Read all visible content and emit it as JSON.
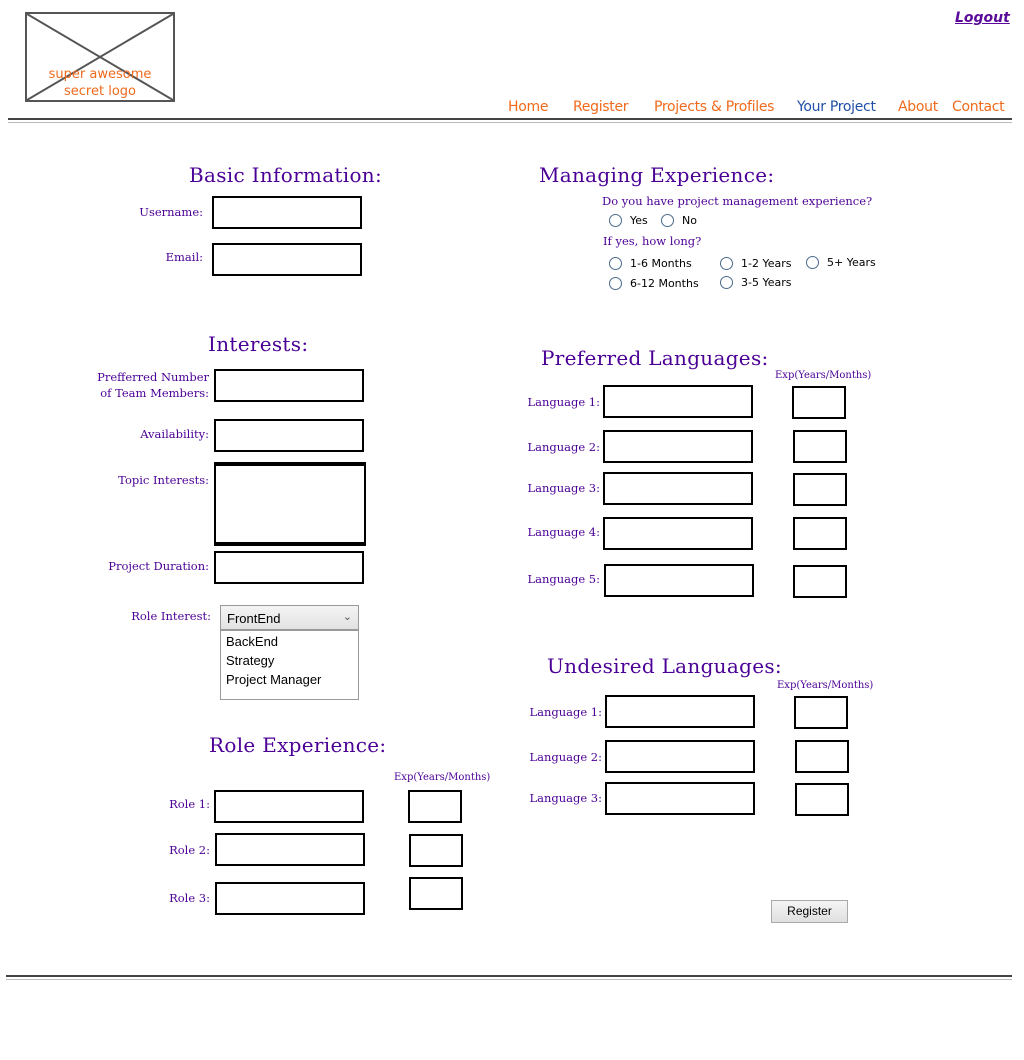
{
  "header": {
    "logo_text_1": "super awesome",
    "logo_text_2": "secret logo",
    "logout": "Logout",
    "nav": [
      "Home",
      "Register",
      "Projects & Profiles",
      "Your Project",
      "About",
      "Contact"
    ]
  },
  "basic": {
    "title": "Basic Information:",
    "username_label": "Username:",
    "email_label": "Email:"
  },
  "interests": {
    "title": "Interests:",
    "team_label_1": "Prefferred Number",
    "team_label_2": "of Team Members:",
    "availability_label": "Availability:",
    "topic_label": "Topic Interests:",
    "duration_label": "Project Duration:",
    "role_label": "Role Interest:",
    "role_selected": "FrontEnd",
    "role_options": [
      "BackEnd",
      "Strategy",
      "Project Manager"
    ]
  },
  "role_exp": {
    "title": "Role Experience:",
    "exp_label": "Exp(Years/Months)",
    "roles": [
      "Role 1:",
      "Role 2:",
      "Role 3:"
    ]
  },
  "managing": {
    "title": "Managing Experience:",
    "question": "Do you have project management experience?",
    "yes": "Yes",
    "no": "No",
    "how_long": "If yes, how long?",
    "durations": [
      "1-6 Months",
      "1-2 Years",
      "5+ Years",
      "6-12 Months",
      "3-5 Years"
    ]
  },
  "preferred": {
    "title": "Preferred Languages:",
    "exp_label": "Exp(Years/Months)",
    "languages": [
      "Language 1:",
      "Language 2:",
      "Language 3:",
      "Language 4:",
      "Language 5:"
    ]
  },
  "undesired": {
    "title": "Undesired Languages:",
    "exp_label": "Exp(Years/Months)",
    "languages": [
      "Language 1:",
      "Language 2:",
      "Language 3:"
    ]
  },
  "register_button": "Register"
}
